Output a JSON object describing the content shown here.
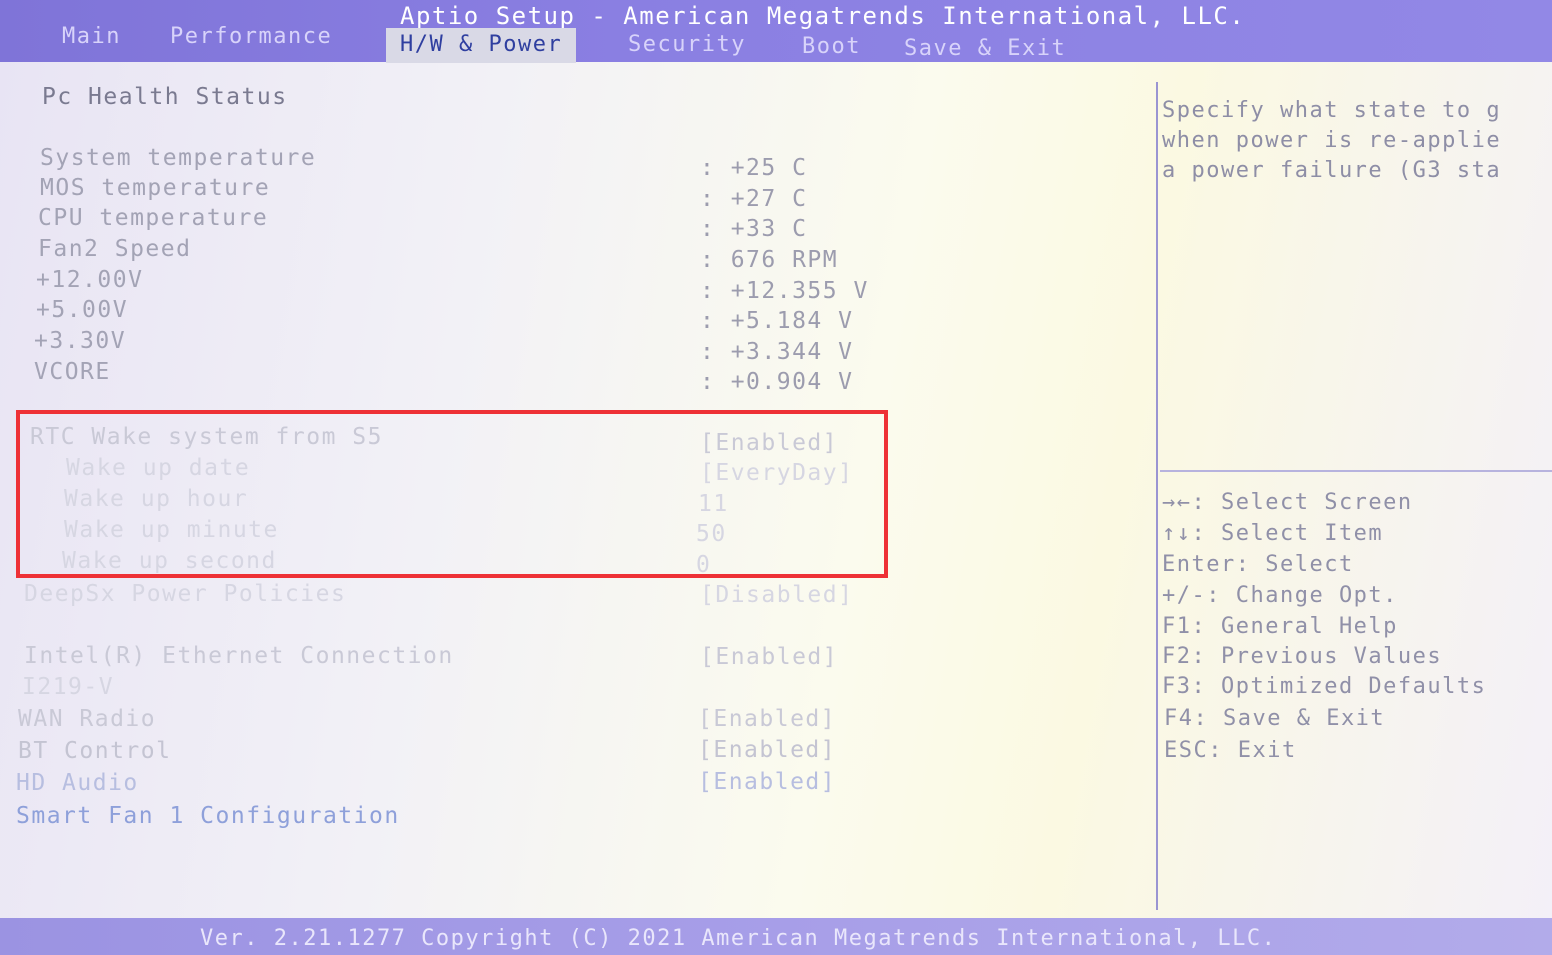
{
  "app_title": "Aptio Setup - American Megatrends International, LLC.",
  "tabs": [
    "Main",
    "Performance",
    "H/W & Power",
    "Security",
    "Boot",
    "Save & Exit"
  ],
  "active_tab": "H/W & Power",
  "section_title": "Pc Health Status",
  "readings": [
    {
      "label": "System temperature",
      "value": ": +25 C"
    },
    {
      "label": "MOS temperature",
      "value": ": +27 C"
    },
    {
      "label": "CPU temperature",
      "value": ": +33 C"
    },
    {
      "label": "Fan2 Speed",
      "value": ": 676 RPM"
    },
    {
      "label": "+12.00V",
      "value": ": +12.355 V"
    },
    {
      "label": "+5.00V",
      "value": ": +5.184 V"
    },
    {
      "label": "+3.30V",
      "value": ": +3.344 V"
    },
    {
      "label": "VCORE",
      "value": ": +0.904 V"
    }
  ],
  "settings": [
    {
      "label": "RTC Wake system from S5",
      "value": "[Enabled]"
    },
    {
      "label": "Wake up date",
      "value": "[EveryDay]"
    },
    {
      "label": "Wake up hour",
      "value": "11"
    },
    {
      "label": "Wake up minute",
      "value": "50"
    },
    {
      "label": "Wake up second",
      "value": "0"
    },
    {
      "label": "DeepSx Power Policies",
      "value": "[Disabled]"
    },
    {
      "label": "Intel(R) Ethernet Connection",
      "value": "[Enabled]"
    },
    {
      "label": "I219-V",
      "value": ""
    },
    {
      "label": "WAN Radio",
      "value": "[Enabled]"
    },
    {
      "label": "BT Control",
      "value": "[Enabled]"
    },
    {
      "label": "HD Audio",
      "value": "[Enabled]"
    },
    {
      "label": "Smart Fan 1 Configuration",
      "value": ""
    }
  ],
  "help_lines": [
    "Specify what state to g",
    "when power is re-applie",
    "a power failure (G3 sta"
  ],
  "key_help": [
    "→←: Select Screen",
    "↑↓: Select Item",
    "Enter: Select",
    "+/-: Change Opt.",
    "F1: General Help",
    "F2: Previous Values",
    "F3: Optimized Defaults",
    "F4: Save & Exit",
    "ESC: Exit"
  ],
  "footer": "Ver. 2.21.1277 Copyright (C) 2021 American Megatrends International, LLC.",
  "colors": {
    "header": "#8a7fe2",
    "highlight_box": "#ee3136",
    "active_tab_bg": "#d9d9e6"
  }
}
